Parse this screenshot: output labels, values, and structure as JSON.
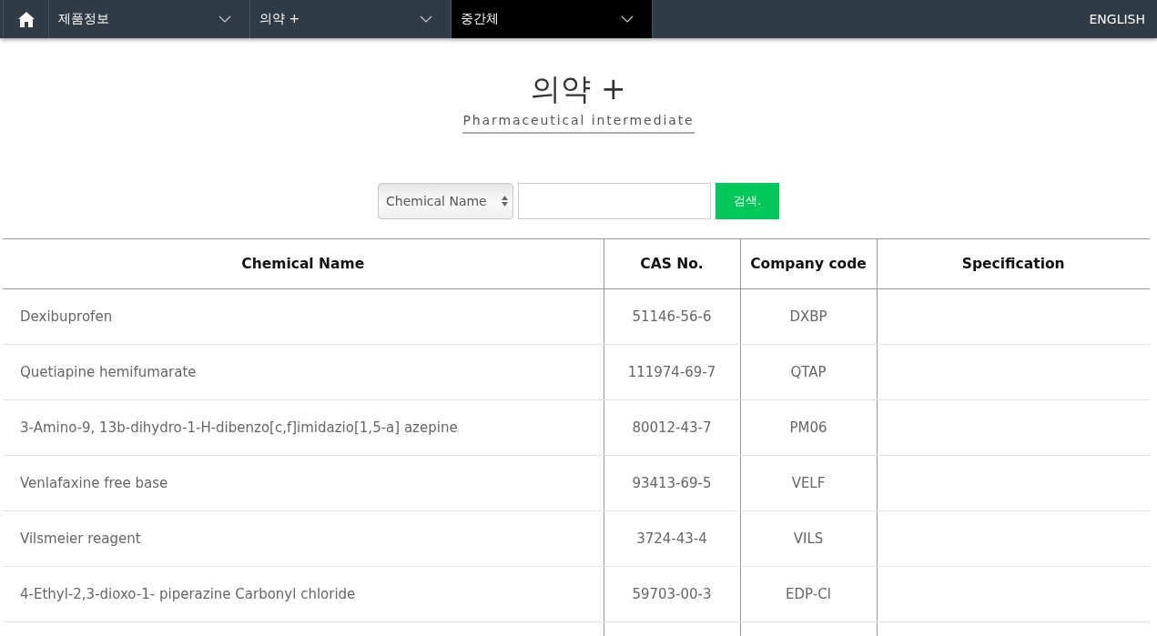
{
  "nav": {
    "items": [
      {
        "label": "제품정보",
        "selected": false
      },
      {
        "label": "의약 +",
        "selected": false
      },
      {
        "label": "중간체",
        "selected": true
      }
    ],
    "language": "ENGLISH"
  },
  "heading": {
    "title": "의약 +",
    "subtitle": "Pharmaceutical intermediate"
  },
  "search": {
    "field_select": "Chemical Name",
    "button": "검색."
  },
  "table": {
    "columns": [
      "Chemical Name",
      "CAS No.",
      "Company code",
      "Specification"
    ],
    "rows": [
      [
        "Dexibuprofen",
        "51146-56-6",
        "DXBP"
      ],
      [
        "Quetiapine hemifumarate",
        "111974-69-7",
        "QTAP"
      ],
      [
        "3-Amino-9, 13b-dihydro-1-H-dibenzo[c,f]imidazio[1,5-a] azepine",
        "80012-43-7",
        "PM06"
      ],
      [
        "Venlafaxine free base",
        "93413-69-5",
        "VELF"
      ],
      [
        "Vilsmeier reagent",
        "3724-43-4",
        "VILS"
      ],
      [
        "4-Ethyl-2,3-dioxo-1- piperazine Carbonyl chloride",
        "59703-00-3",
        "EDP-Cl"
      ]
    ]
  }
}
